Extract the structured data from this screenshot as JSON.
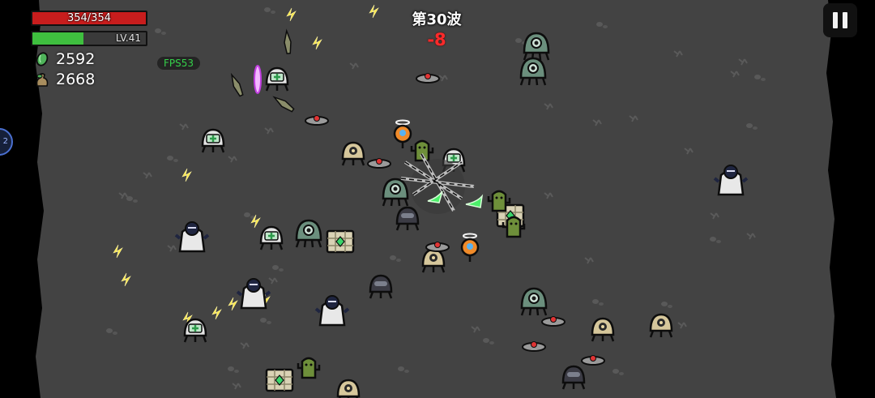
{
  "hud": {
    "hp_text": "354/354",
    "hp_fraction": 1.0,
    "level_text": "LV.41",
    "xp_fraction": 0.45,
    "gems": "2592",
    "bag": "2668",
    "fps": "FPS53",
    "wave": "第30波",
    "damage": "-8"
  },
  "icons": {
    "gems": "green-gem-icon",
    "bag": "money-bag-icon",
    "pause": "pause-icon",
    "side": "ability-orb-icon"
  },
  "colors": {
    "hp": "#c81d1d",
    "xp": "#3fbf3f",
    "fps_text": "#35d04a",
    "damage": "#ff2a2a",
    "arena": "#434343"
  }
}
